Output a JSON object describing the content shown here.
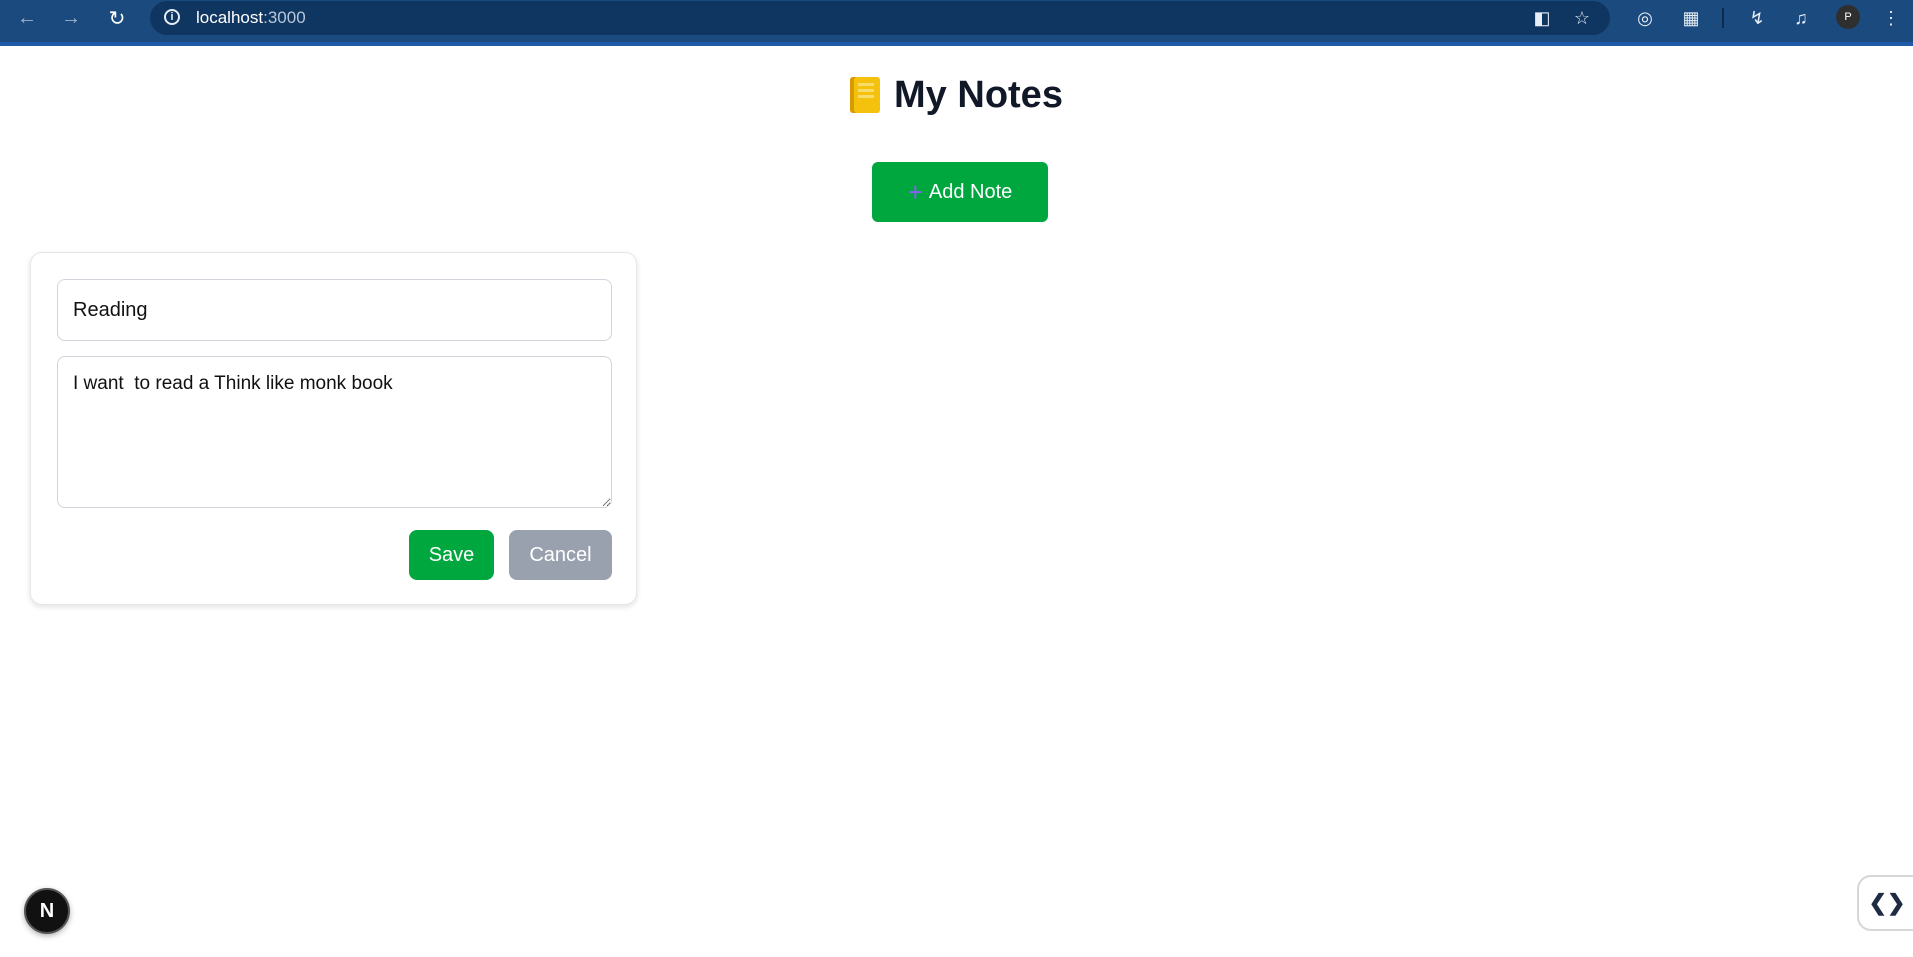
{
  "browser": {
    "url_host": "localhost",
    "url_port": ":3000",
    "avatar_letter": "P"
  },
  "page": {
    "title": "My Notes",
    "add_button_label": "Add Note"
  },
  "editor": {
    "title_value": "Reading",
    "body_value": "I want  to read a Think like monk book",
    "save_label": "Save",
    "cancel_label": "Cancel"
  },
  "overlay": {
    "next_badge": "N"
  },
  "colors": {
    "primary": "#00a63e",
    "secondary": "#99a1af",
    "chrome": "#1b4a7e"
  }
}
